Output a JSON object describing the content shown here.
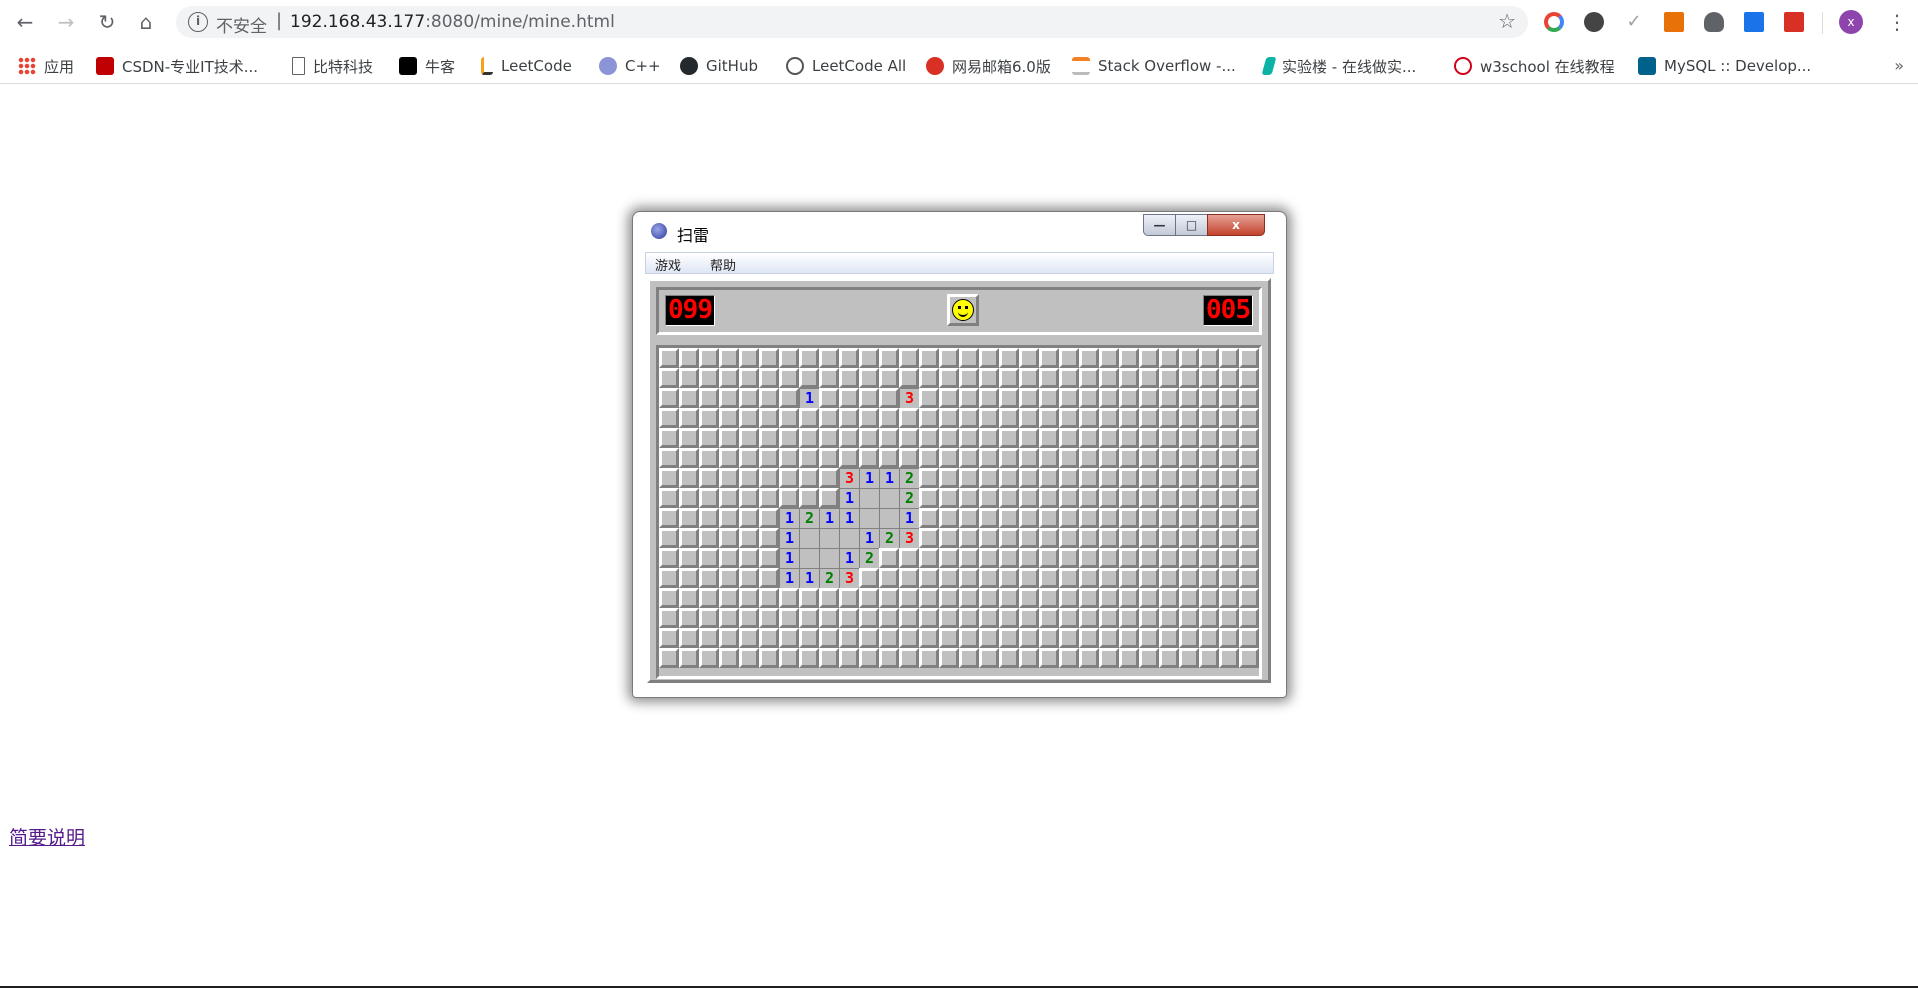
{
  "browser": {
    "omnibox": {
      "insecure_label": "不安全",
      "separator": "|",
      "host": "192.168.43.177",
      "path": ":8080/mine/mine.html"
    },
    "profile_initial": "x"
  },
  "bookmarks": [
    {
      "label": "应用",
      "icon": "apps-grid-icon",
      "color": "#ea4335"
    },
    {
      "label": "CSDN-专业IT技术...",
      "icon": "csdn-icon",
      "color": "#c00000"
    },
    {
      "label": "比特科技",
      "icon": "page-icon",
      "color": "#5f6368"
    },
    {
      "label": "牛客",
      "icon": "nowcoder-icon",
      "color": "#000000"
    },
    {
      "label": "LeetCode",
      "icon": "leetcode-icon",
      "color": "#f89f1b"
    },
    {
      "label": "C++",
      "icon": "cpp-icon",
      "color": "#5b6bc0"
    },
    {
      "label": "GitHub",
      "icon": "github-icon",
      "color": "#24292e"
    },
    {
      "label": "LeetCode All",
      "icon": "leetcode-all-icon",
      "color": "#555555"
    },
    {
      "label": "网易邮箱6.0版",
      "icon": "netease-mail-icon",
      "color": "#d93025"
    },
    {
      "label": "Stack Overflow -...",
      "icon": "stackoverflow-icon",
      "color": "#f48024"
    },
    {
      "label": "实验楼 - 在线做实...",
      "icon": "shiyanlou-icon",
      "color": "#0bb3a5"
    },
    {
      "label": "w3school 在线教程",
      "icon": "w3school-icon",
      "color": "#d0021b"
    },
    {
      "label": "MySQL :: Develop...",
      "icon": "mysql-icon",
      "color": "#00618a"
    }
  ],
  "bookmarks_more": "»",
  "window": {
    "title": "扫雷",
    "close_glyph": "x",
    "menu": [
      "游戏",
      "帮助"
    ]
  },
  "game": {
    "mine_counter": "099",
    "timer": "005",
    "rows": 16,
    "cols": 30,
    "opened_cells": [
      {
        "r": 2,
        "c": 7,
        "v": 1
      },
      {
        "r": 2,
        "c": 12,
        "v": 3
      },
      {
        "r": 6,
        "c": 9,
        "v": 3
      },
      {
        "r": 6,
        "c": 10,
        "v": 1
      },
      {
        "r": 6,
        "c": 11,
        "v": 1
      },
      {
        "r": 6,
        "c": 12,
        "v": 2
      },
      {
        "r": 7,
        "c": 9,
        "v": 1
      },
      {
        "r": 7,
        "c": 10,
        "v": 0
      },
      {
        "r": 7,
        "c": 11,
        "v": 0
      },
      {
        "r": 7,
        "c": 12,
        "v": 2
      },
      {
        "r": 8,
        "c": 6,
        "v": 1
      },
      {
        "r": 8,
        "c": 7,
        "v": 2
      },
      {
        "r": 8,
        "c": 8,
        "v": 1
      },
      {
        "r": 8,
        "c": 9,
        "v": 1
      },
      {
        "r": 8,
        "c": 10,
        "v": 0
      },
      {
        "r": 8,
        "c": 11,
        "v": 0
      },
      {
        "r": 8,
        "c": 12,
        "v": 1
      },
      {
        "r": 9,
        "c": 6,
        "v": 1
      },
      {
        "r": 9,
        "c": 7,
        "v": 0
      },
      {
        "r": 9,
        "c": 8,
        "v": 0
      },
      {
        "r": 9,
        "c": 9,
        "v": 0
      },
      {
        "r": 9,
        "c": 10,
        "v": 1
      },
      {
        "r": 9,
        "c": 11,
        "v": 2
      },
      {
        "r": 9,
        "c": 12,
        "v": 3
      },
      {
        "r": 10,
        "c": 6,
        "v": 1
      },
      {
        "r": 10,
        "c": 7,
        "v": 0
      },
      {
        "r": 10,
        "c": 8,
        "v": 0
      },
      {
        "r": 10,
        "c": 9,
        "v": 1
      },
      {
        "r": 10,
        "c": 10,
        "v": 2
      },
      {
        "r": 11,
        "c": 6,
        "v": 1
      },
      {
        "r": 11,
        "c": 7,
        "v": 1
      },
      {
        "r": 11,
        "c": 8,
        "v": 2
      },
      {
        "r": 11,
        "c": 9,
        "v": 3
      }
    ]
  },
  "page": {
    "help_link": "简要说明"
  }
}
